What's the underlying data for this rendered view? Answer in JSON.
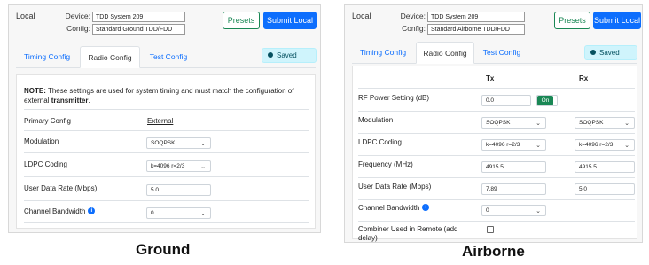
{
  "ground": {
    "local_label": "Local",
    "device_label": "Device:",
    "device_value": "TDD System 209",
    "config_label": "Config:",
    "config_value": "Standard Ground TDD/FDD",
    "presets_label": "Presets",
    "submit_label": "Submit Local",
    "tabs": [
      "Timing Config",
      "Radio Config",
      "Test Config"
    ],
    "saved_label": "Saved",
    "note_prefix": "NOTE:",
    "note_text": " These settings are used for system timing and must match the configuration of external ",
    "note_bold": "transmitter",
    "note_end": ".",
    "rows": {
      "primary_config": {
        "label": "Primary Config",
        "value": "External"
      },
      "modulation": {
        "label": "Modulation",
        "value": "SOQPSK"
      },
      "ldpc": {
        "label": "LDPC Coding",
        "value": "k=4096 r=2/3"
      },
      "data_rate": {
        "label": "User Data Rate (Mbps)",
        "value": "5.0"
      },
      "bandwidth": {
        "label": "Channel Bandwidth",
        "value": "0"
      }
    }
  },
  "airborne": {
    "local_label": "Local",
    "device_label": "Device:",
    "device_value": "TDD System 209",
    "config_label": "Config:",
    "config_value": "Standard Airborne TDD/FDD",
    "presets_label": "Presets",
    "submit_label": "Submit Local",
    "tabs": [
      "Timing Config",
      "Radio Config",
      "Test Config"
    ],
    "saved_label": "Saved",
    "tx_header": "Tx",
    "rx_header": "Rx",
    "rows": {
      "rf_power": {
        "label": "RF Power Setting (dB)",
        "tx": "0.0",
        "toggle": "On"
      },
      "modulation": {
        "label": "Modulation",
        "tx": "SOQPSK",
        "rx": "SOQPSK"
      },
      "ldpc": {
        "label": "LDPC Coding",
        "tx": "k=4096 r=2/3",
        "rx": "k=4096 r=2/3"
      },
      "frequency": {
        "label": "Frequency (MHz)",
        "tx": "4915.5",
        "rx": "4915.5"
      },
      "data_rate": {
        "label": "User Data Rate (Mbps)",
        "tx": "7.89",
        "rx": "5.0"
      },
      "bandwidth": {
        "label": "Channel Bandwidth",
        "tx": "0"
      },
      "combiner": {
        "label_line1": "Combiner Used in Remote (add",
        "label_line2": "delay)"
      }
    }
  },
  "captions": {
    "ground": "Ground",
    "airborne": "Airborne"
  },
  "colors": {
    "primary": "#0d6efd",
    "success": "#198754",
    "info_bg": "#cff4fc"
  }
}
